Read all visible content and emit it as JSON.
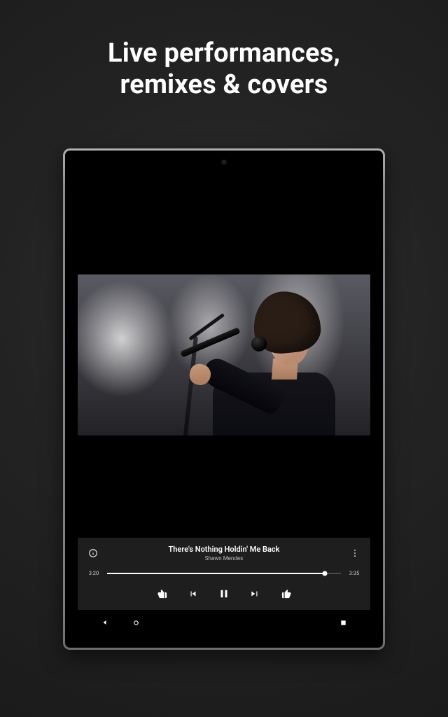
{
  "headline": "Live performances,\nremixes & covers",
  "player": {
    "title": "There's Nothing Holdin' Me Back",
    "artist": "Shawn Mendes",
    "elapsed": "3:20",
    "duration": "3:35",
    "progress_percent": 93
  },
  "icons": {
    "info": "info",
    "more": "more-vert",
    "dislike": "thumb-down",
    "previous": "skip-previous",
    "playpause": "pause",
    "next": "skip-next",
    "like": "thumb-up"
  },
  "android_nav": {
    "back": "back",
    "home": "home",
    "recent": "recent"
  }
}
